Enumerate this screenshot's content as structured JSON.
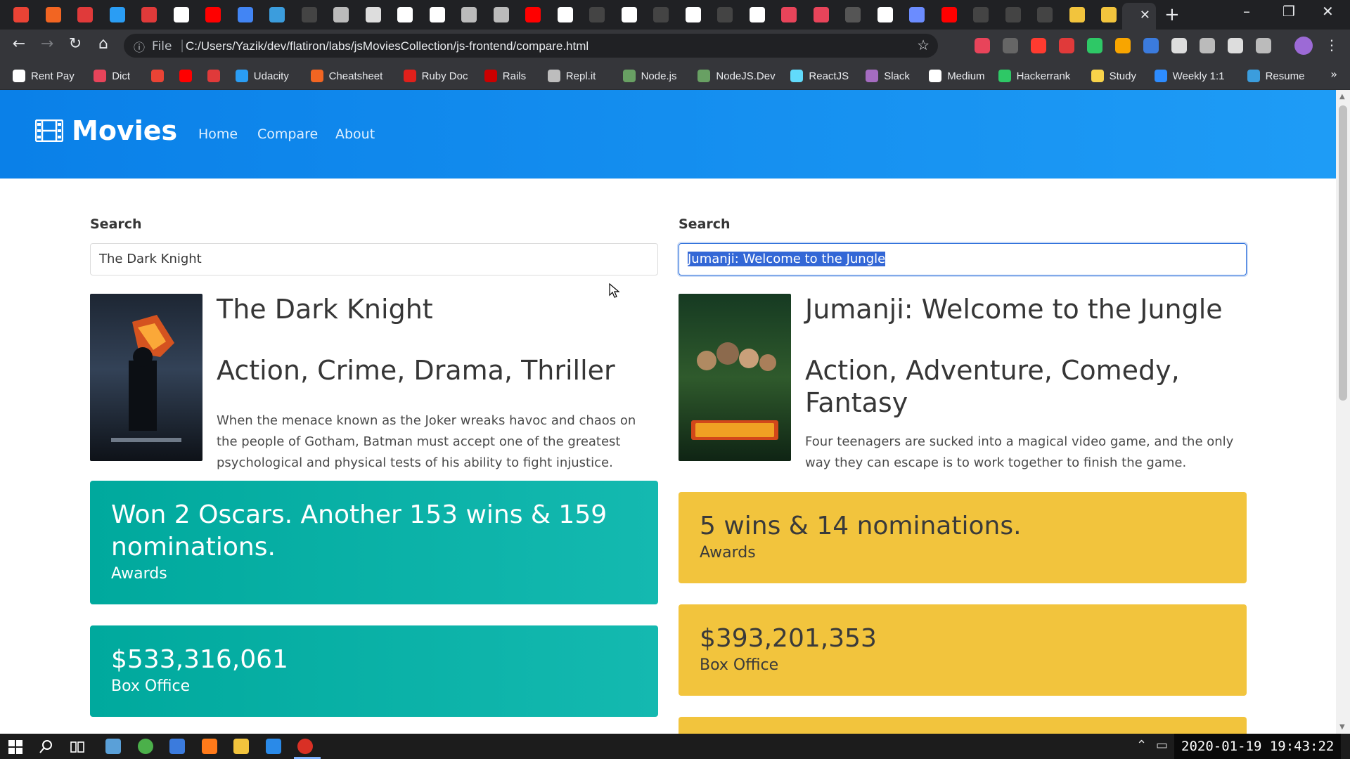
{
  "browser": {
    "tab_close": "✕",
    "new_tab": "+",
    "win_minimize": "–",
    "win_restore": "❐",
    "win_close": "✕",
    "nav_back": "←",
    "nav_forward": "→",
    "nav_reload": "↻",
    "nav_home": "⌂",
    "info_icon": "ⓘ",
    "scheme_label": "File",
    "url": "C:/Users/Yazik/dev/flatiron/labs/jsMoviesCollection/js-frontend/compare.html",
    "star": "☆",
    "menu": "⋮",
    "bookmarks_more": "»"
  },
  "bookmarks": [
    {
      "label": "Rent Pay",
      "color": "#ffffff"
    },
    {
      "label": "Dict",
      "color": "#e8445a"
    },
    {
      "label": "",
      "color": "#ea4335"
    },
    {
      "label": "",
      "color": "#ff0000"
    },
    {
      "label": "",
      "color": "#e03a3a"
    },
    {
      "label": "Udacity",
      "color": "#2a9df4"
    },
    {
      "label": "Cheatsheet",
      "color": "#f26522"
    },
    {
      "label": "Ruby Doc",
      "color": "#e0201b"
    },
    {
      "label": "Rails",
      "color": "#cc0000"
    },
    {
      "label": "Repl.it",
      "color": "#bdbdbd"
    },
    {
      "label": "Node.js",
      "color": "#68a063"
    },
    {
      "label": "NodeJS.Dev",
      "color": "#68a063"
    },
    {
      "label": "ReactJS",
      "color": "#61dafb"
    },
    {
      "label": "Slack",
      "color": "#a56cc1"
    },
    {
      "label": "Medium",
      "color": "#ffffff"
    },
    {
      "label": "Hackerrank",
      "color": "#2ec866"
    },
    {
      "label": "Study",
      "color": "#f8d34a"
    },
    {
      "label": "Weekly 1:1",
      "color": "#2d8cff"
    },
    {
      "label": "Resume",
      "color": "#3b9ddd"
    }
  ],
  "page": {
    "brand": "Movies",
    "nav": [
      "Home",
      "Compare",
      "About"
    ],
    "left": {
      "search_label": "Search",
      "search_value": "The Dark Knight",
      "title": "The Dark Knight",
      "genre": "Action, Crime, Drama, Thriller",
      "plot": "When the menace known as the Joker wreaks havoc and chaos on the people of Gotham, Batman must accept one of the greatest psychological and physical tests of his ability to fight injustice.",
      "awards_value": "Won 2 Oscars. Another 153 wins & 159 nominations.",
      "awards_label": "Awards",
      "box_value": "$533,316,061",
      "box_label": "Box Office"
    },
    "right": {
      "search_label": "Search",
      "search_value": "Jumanji: Welcome to the Jungle",
      "title": "Jumanji: Welcome to the Jungle",
      "genre": "Action, Adventure, Comedy, Fantasy",
      "plot": "Four teenagers are sucked into a magical video game, and the only way they can escape is to work together to finish the game.",
      "awards_value": "5 wins & 14 nominations.",
      "awards_label": "Awards",
      "box_value": "$393,201,353",
      "box_label": "Box Office"
    }
  },
  "taskbar": {
    "clock": "2020-01-19 19:43:22"
  },
  "colors": {
    "hero": "#0a80e8",
    "teal": "#00a99d",
    "gold": "#f2c43d",
    "focus": "#3273dc"
  }
}
